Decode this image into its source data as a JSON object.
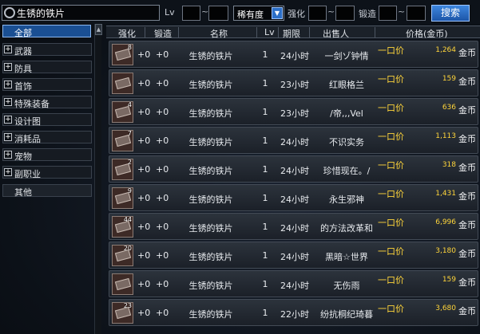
{
  "search": {
    "value": "生锈的铁片",
    "lv_label": "Lv",
    "tilde": "~",
    "rarity": "稀有度",
    "strength_label": "强化",
    "forge_label": "锻造",
    "button": "搜索"
  },
  "sidebar": {
    "all": "全部",
    "items": [
      {
        "label": "武器"
      },
      {
        "label": "防具"
      },
      {
        "label": "首饰"
      },
      {
        "label": "特殊装备"
      },
      {
        "label": "设计图"
      },
      {
        "label": "消耗品"
      },
      {
        "label": "宠物"
      },
      {
        "label": "副职业"
      }
    ],
    "other": "其他",
    "scroll_arrow": "▲"
  },
  "table": {
    "headers": {
      "strength": "强化",
      "forge": "锻造",
      "name": "名称",
      "lv": "Lv",
      "time": "期限",
      "seller": "出售人",
      "price": "价格(金币)"
    },
    "buyout_label": "一口价",
    "unit": "金币",
    "rows": [
      {
        "count": "8",
        "strength": "+0",
        "forge": "+0",
        "name": "生锈的铁片",
        "lv": "1",
        "time": "24小时",
        "seller": "一剑ゾ钟情",
        "price": "1,264"
      },
      {
        "count": "",
        "strength": "+0",
        "forge": "+0",
        "name": "生锈的铁片",
        "lv": "1",
        "time": "23小时",
        "seller": "红眼格兰",
        "price": "159"
      },
      {
        "count": "4",
        "strength": "+0",
        "forge": "+0",
        "name": "生锈的铁片",
        "lv": "1",
        "time": "23小时",
        "seller": "/帝,,,Vel",
        "price": "636"
      },
      {
        "count": "7",
        "strength": "+0",
        "forge": "+0",
        "name": "生锈的铁片",
        "lv": "1",
        "time": "24小时",
        "seller": "不识实务",
        "price": "1,113"
      },
      {
        "count": "2",
        "strength": "+0",
        "forge": "+0",
        "name": "生锈的铁片",
        "lv": "1",
        "time": "24小时",
        "seller": "珍惜现在。/",
        "price": "318"
      },
      {
        "count": "9",
        "strength": "+0",
        "forge": "+0",
        "name": "生锈的铁片",
        "lv": "1",
        "time": "24小时",
        "seller": "永生邪神",
        "price": "1,431"
      },
      {
        "count": "44",
        "strength": "+0",
        "forge": "+0",
        "name": "生锈的铁片",
        "lv": "1",
        "time": "24小时",
        "seller": "的方法改革和",
        "price": "6,996"
      },
      {
        "count": "20",
        "strength": "+0",
        "forge": "+0",
        "name": "生锈的铁片",
        "lv": "1",
        "time": "24小时",
        "seller": "黑暗☆世界",
        "price": "3,180"
      },
      {
        "count": "",
        "strength": "+0",
        "forge": "+0",
        "name": "生锈的铁片",
        "lv": "1",
        "time": "24小时",
        "seller": "无伤雨",
        "price": "159"
      },
      {
        "count": "23",
        "strength": "+0",
        "forge": "+0",
        "name": "生锈的铁片",
        "lv": "1",
        "time": "22小时",
        "seller": "纷抗桐纪琦暮",
        "price": "3,680"
      }
    ]
  },
  "colors": {
    "accent": "#2c6fc7",
    "price": "#ffd53a"
  }
}
